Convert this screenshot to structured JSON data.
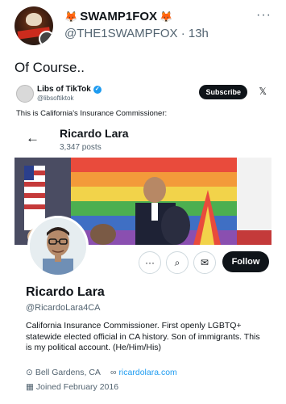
{
  "post": {
    "display_name": "SWAMP1FOX",
    "fox_emoji": "🦊",
    "handle": "@THE1SWAMPFOX",
    "separator": "·",
    "time": "13h",
    "more": "···",
    "text": "Of Course.."
  },
  "quote": {
    "name": "Libs of TikTok",
    "handle": "@libsoftiktok",
    "subscribe_label": "Subscribe",
    "x_icon": "𝕏",
    "text": "This is California's Insurance Commissioner:"
  },
  "profile": {
    "back_icon": "←",
    "header_name": "Ricardo Lara",
    "posts": "3,347 posts",
    "name": "Ricardo Lara",
    "handle": "@RicardoLara4CA",
    "bio": "California Insurance Commissioner. First openly LGBTQ+ statewide elected official in CA history. Son of immigrants. This is my political account. (He/Him/His)",
    "location": "Bell Gardens, CA",
    "website": "ricardolara.com",
    "joined": "Joined February 2016",
    "follow_label": "Follow",
    "more_icon": "···",
    "search_icon": "⌕",
    "message_icon": "✉"
  },
  "colors": {
    "accent": "#1d9bf0",
    "text": "#0f1419",
    "muted": "#536471"
  }
}
